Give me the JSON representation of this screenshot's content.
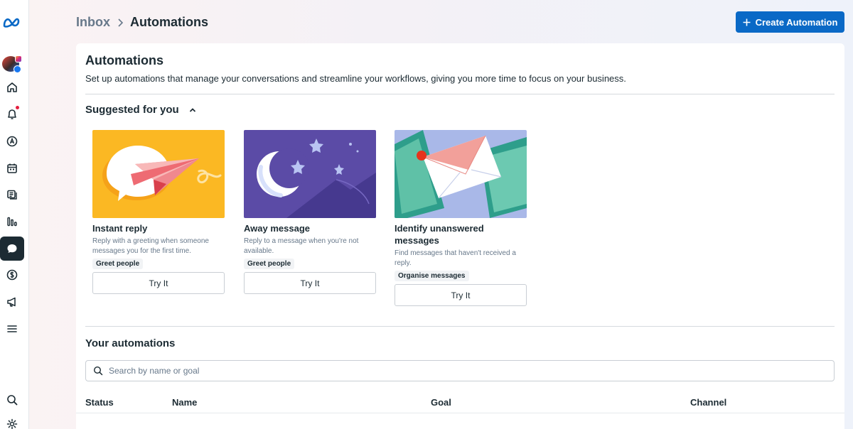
{
  "sidebar": {
    "items": [
      {
        "name": "home-icon"
      },
      {
        "name": "notifications-icon"
      },
      {
        "name": "ads-icon"
      },
      {
        "name": "planner-icon"
      },
      {
        "name": "content-icon"
      },
      {
        "name": "insights-icon"
      },
      {
        "name": "inbox-icon",
        "active": true
      },
      {
        "name": "monetization-icon"
      },
      {
        "name": "advertise-icon"
      },
      {
        "name": "menu-icon"
      },
      {
        "name": "search-icon"
      },
      {
        "name": "settings-icon"
      }
    ]
  },
  "header": {
    "breadcrumb_root": "Inbox",
    "breadcrumb_current": "Automations",
    "create_button": "Create Automation"
  },
  "main": {
    "title": "Automations",
    "description": "Set up automations that manage your conversations and streamline your workflows, giving you more time to focus on your business.",
    "suggested_title": "Suggested for you",
    "suggestions": [
      {
        "title": "Instant reply",
        "description": "Reply with a greeting when someone messages you for the first time.",
        "tag": "Greet people",
        "button": "Try It"
      },
      {
        "title": "Away message",
        "description": "Reply to a message when you're not available.",
        "tag": "Greet people",
        "button": "Try It"
      },
      {
        "title": "Identify unanswered messages",
        "description": "Find messages that haven't received a reply.",
        "tag": "Organise messages",
        "button": "Try It"
      }
    ],
    "your_automations_title": "Your automations",
    "search_placeholder": "Search by name or goal",
    "table_headers": [
      "Status",
      "Name",
      "Goal",
      "Channel"
    ]
  },
  "colors": {
    "accent": "#0a69c6",
    "text": "#1c2b33",
    "muted": "#67788a",
    "tile_instant_bg": "#fbb823",
    "tile_away_bg": "#5b4ba6",
    "tile_unanswered_bg": "#a9b8e8"
  }
}
